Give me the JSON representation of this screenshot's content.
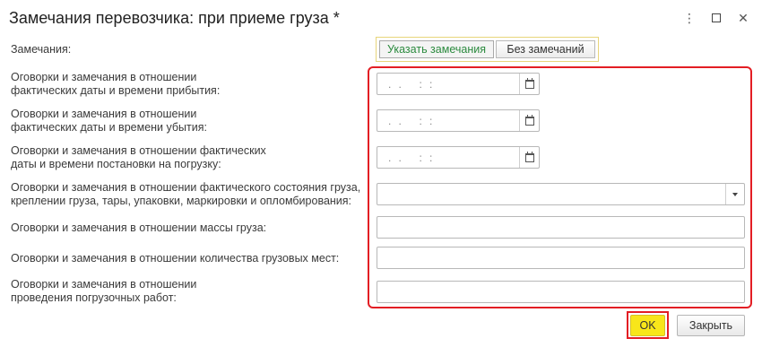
{
  "window": {
    "title": "Замечания перевозчика: при приеме груза *",
    "more_label": "⋮",
    "close_label": "✕"
  },
  "remarks": {
    "label": "Замечания:",
    "options": [
      "Указать замечания",
      "Без замечаний"
    ],
    "selected": "Указать замечания"
  },
  "fields": [
    {
      "label": "Оговорки и замечания в отношении\nфактических даты и времени прибытия:",
      "type": "datetime",
      "value": ".  .     :  :"
    },
    {
      "label": "Оговорки и замечания в отношении\nфактических даты и времени убытия:",
      "type": "datetime",
      "value": ".  .     :  :"
    },
    {
      "label": "Оговорки и замечания в отношении фактических\nдаты и времени постановки на погрузку:",
      "type": "datetime",
      "value": ".  .     :  :"
    },
    {
      "label": "Оговорки и замечания в отношении фактического состояния груза,\nкреплении груза, тары, упаковки, маркировки и опломбирования:",
      "type": "select",
      "value": ""
    },
    {
      "label": "Оговорки и замечания в отношении массы груза:",
      "type": "text",
      "value": ""
    },
    {
      "label": "Оговорки и замечания в отношении количества грузовых мест:",
      "type": "text",
      "value": ""
    },
    {
      "label": "Оговорки и замечания в отношении\nпроведения погрузочных работ:",
      "type": "text",
      "value": ""
    }
  ],
  "footer": {
    "ok_label": "OK",
    "close_label": "Закрыть"
  }
}
